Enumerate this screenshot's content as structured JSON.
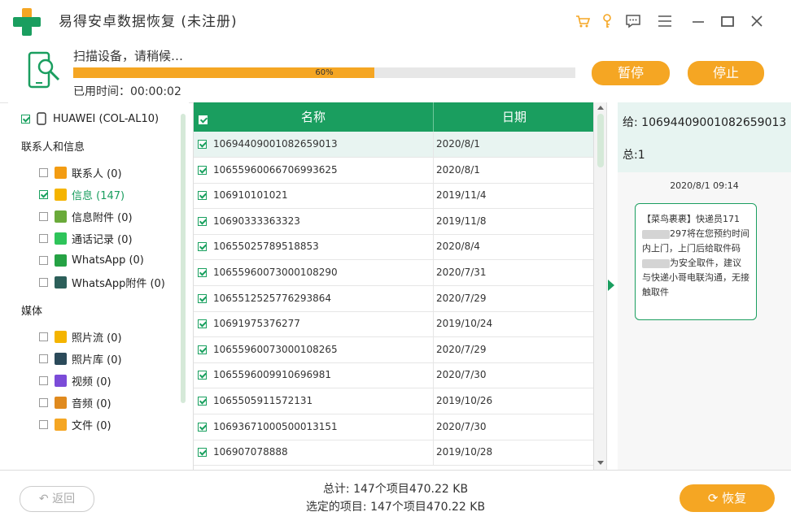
{
  "app": {
    "title": "易得安卓数据恢复 (未注册)",
    "accent": "#1a9e5f",
    "orange": "#f5a623"
  },
  "titlebar": {
    "icons": [
      "cart-icon",
      "key-icon",
      "chat-icon",
      "menu-icon",
      "minimize-icon",
      "maximize-icon",
      "close-icon"
    ]
  },
  "scan": {
    "status": "扫描设备，请稍候…",
    "progress_label": "60%",
    "progress_value": 0.6,
    "elapsed": "已用时间：00:00:02",
    "pause_label": "暂停",
    "stop_label": "停止"
  },
  "device": {
    "name": "HUAWEI (COL-AL10)",
    "sections": [
      {
        "title": "联系人和信息",
        "items": [
          {
            "label": "联系人 (0)",
            "checked": false,
            "icon": "contacts-icon",
            "color": "#f39c12"
          },
          {
            "label": "信息 (147)",
            "checked": true,
            "icon": "message-icon",
            "color": "#f5b400"
          },
          {
            "label": "信息附件 (0)",
            "checked": false,
            "icon": "attachment-icon",
            "color": "#6aaa3a"
          },
          {
            "label": "通话记录 (0)",
            "checked": false,
            "icon": "call-log-icon",
            "color": "#2ec45a"
          },
          {
            "label": "WhatsApp (0)",
            "checked": false,
            "icon": "whatsapp-icon",
            "color": "#25a244"
          },
          {
            "label": "WhatsApp附件 (0)",
            "checked": false,
            "icon": "whatsapp-attachment-icon",
            "color": "#2c5f5a"
          }
        ]
      },
      {
        "title": "媒体",
        "items": [
          {
            "label": "照片流 (0)",
            "checked": false,
            "icon": "photo-stream-icon",
            "color": "#f4b400"
          },
          {
            "label": "照片库 (0)",
            "checked": false,
            "icon": "photo-library-icon",
            "color": "#2b4a5a"
          },
          {
            "label": "视频 (0)",
            "checked": false,
            "icon": "video-icon",
            "color": "#7b4bd8"
          },
          {
            "label": "音频 (0)",
            "checked": false,
            "icon": "audio-icon",
            "color": "#e08a1e"
          },
          {
            "label": "文件 (0)",
            "checked": false,
            "icon": "file-icon",
            "color": "#f5a623"
          }
        ]
      }
    ]
  },
  "table": {
    "col_name": "名称",
    "col_date": "日期",
    "rows": [
      {
        "name": "1069440900108265​9013",
        "date": "2020/8/1"
      },
      {
        "name": "10655960066706993625",
        "date": "2020/8/1"
      },
      {
        "name": "106910101021",
        "date": "2019/11/4"
      },
      {
        "name": "10690333363323",
        "date": "2019/11/8"
      },
      {
        "name": "10655025789518853",
        "date": "2020/8/4"
      },
      {
        "name": "10655960073000108290",
        "date": "2020/7/31"
      },
      {
        "name": "106551252577629386​4",
        "date": "2020/7/29"
      },
      {
        "name": "10691975376277",
        "date": "2019/10/24"
      },
      {
        "name": "10655960073000108265",
        "date": "2020/7/29"
      },
      {
        "name": "106559600991069698​1",
        "date": "2020/7/30"
      },
      {
        "name": "1065505911572131",
        "date": "2019/10/26"
      },
      {
        "name": "1069367100050001315​1",
        "date": "2020/7/30"
      },
      {
        "name": "106907078888",
        "date": "2019/10/28"
      }
    ]
  },
  "detail": {
    "to": "给: 10694409001082659013",
    "total": "总:1",
    "time": "2020/8/1 09:14",
    "message_parts": [
      "【菜鸟裹裹】快递员171",
      "297将在您预约时间内上门，上门后给取件码",
      "为安全取件，建议与快递小哥电联沟通，无接触取件"
    ]
  },
  "footer": {
    "back_label": "返回",
    "total": "总计: 147个项目470.22 KB",
    "selected": "选定的项目: 147个项目470.22 KB",
    "recover_label": "恢复"
  }
}
